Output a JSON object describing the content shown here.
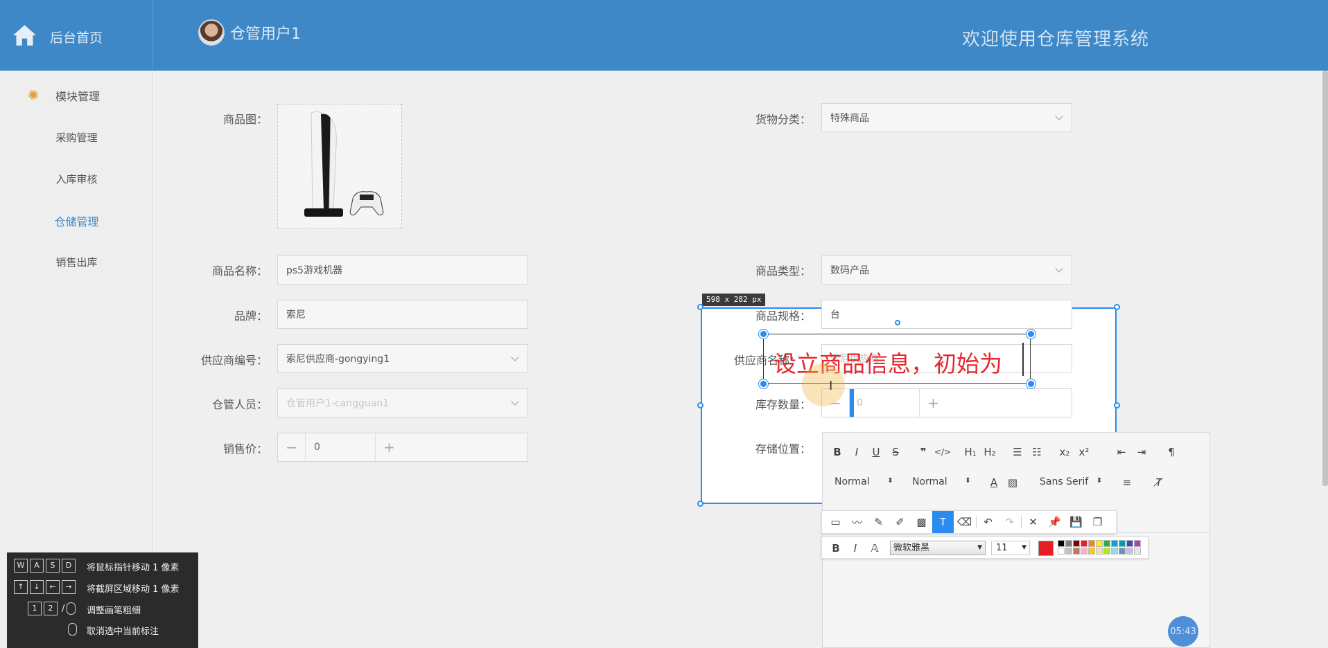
{
  "header": {
    "home_label": "后台首页",
    "user_name": "仓管用户1",
    "welcome": "欢迎使用仓库管理系统"
  },
  "sidebar": {
    "section_title": "模块管理",
    "items": [
      {
        "label": "采购管理",
        "active": false
      },
      {
        "label": "入库审核",
        "active": false
      },
      {
        "label": "仓储管理",
        "active": true
      },
      {
        "label": "销售出库",
        "active": false
      }
    ]
  },
  "form": {
    "image_label": "商品图：",
    "category_label": "货物分类：",
    "category_value": "特殊商品",
    "name_label": "商品名称：",
    "name_value": "ps5游戏机器",
    "type_label": "商品类型：",
    "type_value": "数码产品",
    "brand_label": "品牌：",
    "brand_value": "索尼",
    "spec_label": "商品规格：",
    "spec_value": "台",
    "supplier_code_label": "供应商编号：",
    "supplier_code_value": "索尼供应商-gongying1",
    "supplier_name_label": "供应商名称：",
    "supplier_name_value": "索尼供应商",
    "keeper_label": "仓管人员：",
    "keeper_value": "仓管用户1-cangguan1",
    "stock_label": "库存数量：",
    "stock_value": "0",
    "price_label": "销售价：",
    "price_value": "0",
    "location_label": "存储位置："
  },
  "editor": {
    "header_select_1": "Normal",
    "header_select_2": "Normal",
    "font_select": "Sans Serif"
  },
  "capture": {
    "size_label": "598 x 282  px",
    "annotation_text": "设立商品信息，初始为"
  },
  "annot_toolbar": {
    "font_name": "微软雅黑",
    "font_size": "11",
    "current_color": "#e81c23",
    "palette": [
      "#000000",
      "#808080",
      "#800000",
      "#e81c23",
      "#ff7f27",
      "#fff200",
      "#22b14c",
      "#00a2e8",
      "#00a0a0",
      "#3f48cc",
      "#a349a4",
      "#ffffff",
      "#c3c3c3",
      "#b97a57",
      "#ffaec9",
      "#ffc90e",
      "#efe4b0",
      "#b5e61d",
      "#99d9ea",
      "#7092be",
      "#c8bfe7",
      "#e6e6e6"
    ]
  },
  "help": {
    "rows": [
      {
        "keys": [
          "W",
          "A",
          "S",
          "D"
        ],
        "text": "将鼠标指针移动 1 像素"
      },
      {
        "keys": [
          "↑",
          "↓",
          "←",
          "→"
        ],
        "text": "将截屏区域移动 1 像素"
      },
      {
        "keys": [
          "1",
          "2"
        ],
        "text": "调整画笔粗细"
      },
      {
        "keys": [],
        "text": "取消选中当前标注"
      }
    ]
  },
  "timer": "05:43"
}
